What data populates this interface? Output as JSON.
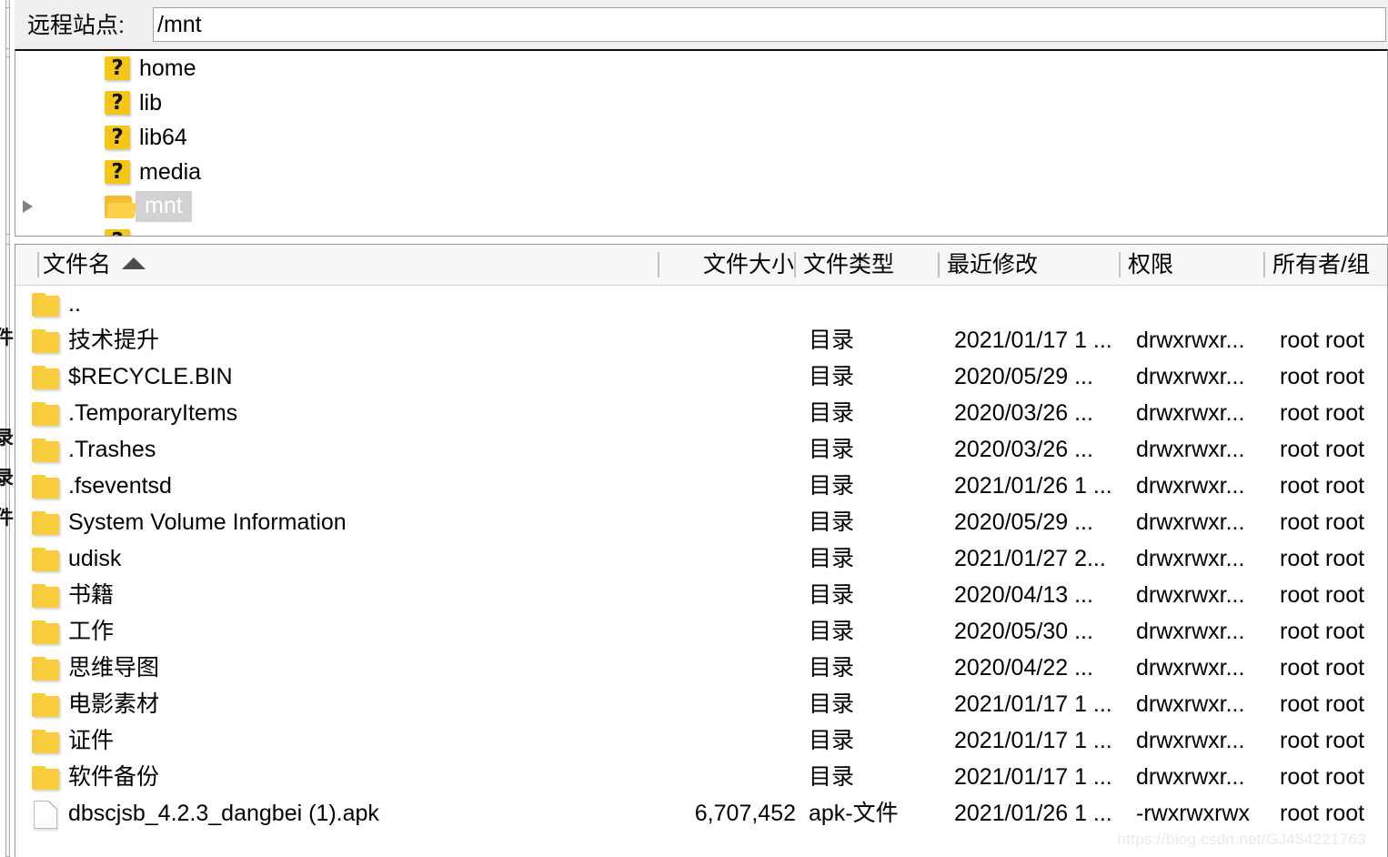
{
  "pathbar": {
    "label": "远程站点:",
    "value": "/mnt",
    "placeholder": "/"
  },
  "tree": {
    "items": [
      {
        "label": "home",
        "icon": "unknown-folder-icon",
        "expander": false,
        "selected": false,
        "glyph": "?"
      },
      {
        "label": "lib",
        "icon": "unknown-folder-icon",
        "expander": false,
        "selected": false,
        "glyph": "?"
      },
      {
        "label": "lib64",
        "icon": "unknown-folder-icon",
        "expander": false,
        "selected": false,
        "glyph": "?"
      },
      {
        "label": "media",
        "icon": "unknown-folder-icon",
        "expander": false,
        "selected": false,
        "glyph": "?"
      },
      {
        "label": "mnt",
        "icon": "open-folder-icon",
        "expander": true,
        "selected": true,
        "glyph": ""
      }
    ]
  },
  "filelist": {
    "columns": [
      {
        "key": "name",
        "label": "文件名",
        "sort": "asc"
      },
      {
        "key": "size",
        "label": "文件大小",
        "sort": ""
      },
      {
        "key": "type",
        "label": "文件类型",
        "sort": ""
      },
      {
        "key": "mtime",
        "label": "最近修改",
        "sort": ""
      },
      {
        "key": "perm",
        "label": "权限",
        "sort": ""
      },
      {
        "key": "owner",
        "label": "所有者/组",
        "sort": ""
      }
    ],
    "rows": [
      {
        "icon": "folder-icon",
        "name": "..",
        "size": "",
        "type": "",
        "mtime": "",
        "perm": "",
        "owner": ""
      },
      {
        "icon": "folder-icon",
        "name": " 技术提升",
        "size": "",
        "type": "目录",
        "mtime": "2021/01/17 1 ...",
        "perm": "drwxrwxr...",
        "owner": "root root"
      },
      {
        "icon": "folder-icon",
        "name": "$RECYCLE.BIN",
        "size": "",
        "type": "目录",
        "mtime": "2020/05/29 ...",
        "perm": "drwxrwxr...",
        "owner": "root root"
      },
      {
        "icon": "folder-icon",
        "name": ".TemporaryItems",
        "size": "",
        "type": "目录",
        "mtime": "2020/03/26 ...",
        "perm": "drwxrwxr...",
        "owner": "root root"
      },
      {
        "icon": "folder-icon",
        "name": ".Trashes",
        "size": "",
        "type": "目录",
        "mtime": "2020/03/26 ...",
        "perm": "drwxrwxr...",
        "owner": "root root"
      },
      {
        "icon": "folder-icon",
        "name": ".fseventsd",
        "size": "",
        "type": "目录",
        "mtime": "2021/01/26 1 ...",
        "perm": "drwxrwxr...",
        "owner": "root root"
      },
      {
        "icon": "folder-icon",
        "name": "System Volume Information",
        "size": "",
        "type": "目录",
        "mtime": "2020/05/29 ...",
        "perm": "drwxrwxr...",
        "owner": "root root"
      },
      {
        "icon": "folder-icon",
        "name": "udisk",
        "size": "",
        "type": "目录",
        "mtime": "2021/01/27 2...",
        "perm": "drwxrwxr...",
        "owner": "root root"
      },
      {
        "icon": "folder-icon",
        "name": "书籍",
        "size": "",
        "type": "目录",
        "mtime": "2020/04/13 ...",
        "perm": "drwxrwxr...",
        "owner": "root root"
      },
      {
        "icon": "folder-icon",
        "name": "工作",
        "size": "",
        "type": "目录",
        "mtime": "2020/05/30 ...",
        "perm": "drwxrwxr...",
        "owner": "root root"
      },
      {
        "icon": "folder-icon",
        "name": "思维导图",
        "size": "",
        "type": "目录",
        "mtime": "2020/04/22 ...",
        "perm": "drwxrwxr...",
        "owner": "root root"
      },
      {
        "icon": "folder-icon",
        "name": "电影素材",
        "size": "",
        "type": "目录",
        "mtime": "2021/01/17 1 ...",
        "perm": "drwxrwxr...",
        "owner": "root root"
      },
      {
        "icon": "folder-icon",
        "name": "证件",
        "size": "",
        "type": "目录",
        "mtime": "2021/01/17 1 ...",
        "perm": "drwxrwxr...",
        "owner": "root root"
      },
      {
        "icon": "folder-icon",
        "name": "软件备份",
        "size": "",
        "type": "目录",
        "mtime": "2021/01/17 1 ...",
        "perm": "drwxrwxr...",
        "owner": "root root"
      },
      {
        "icon": "file-icon",
        "name": "dbscjsb_4.2.3_dangbei (1).apk",
        "size": "6,707,452",
        "type": "apk-文件",
        "mtime": "2021/01/26 1 ...",
        "perm": "-rwxrwxrwx",
        "owner": "root root"
      }
    ]
  },
  "left_strip": {
    "glyphs": [
      "件",
      "录",
      "录",
      "件"
    ]
  },
  "watermark": {
    "text": "https://blog.csdn.net/GJ454221763"
  },
  "colors": {
    "folder": "#F8CC3C",
    "unknown_badge": "#F5C518",
    "selection": "#D2D2D2",
    "panel_bg": "#FFFFFF",
    "toolbar_bg": "#EFEFEF",
    "header_bg": "#F7F7F7"
  }
}
